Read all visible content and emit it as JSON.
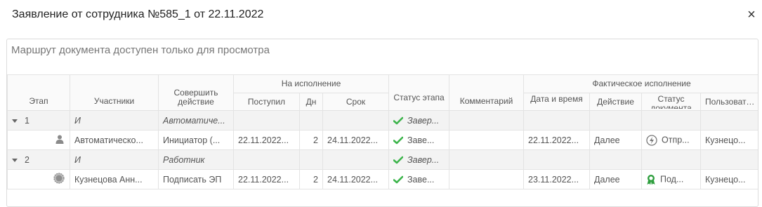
{
  "dialog": {
    "title": "Заявление от сотрудника №585_1 от 22.11.2022",
    "close_label": "×",
    "notice": "Маршрут документа доступен только для просмотра"
  },
  "columns": {
    "stage": "Этап",
    "participants": "Участники",
    "action": "Совершить действие",
    "on_execution": "На исполнение",
    "received": "Поступил",
    "days": "Дн",
    "deadline": "Срок",
    "stage_status": "Статус этапа",
    "comment": "Комментарий",
    "actual_execution": "Фактическое исполнение",
    "datetime": "Дата и время",
    "action_done": "Действие",
    "doc_status": "Статус документа",
    "user": "Пользовате..."
  },
  "rows": [
    {
      "type": "group",
      "stage": "1",
      "participants": "И",
      "action": "Автоматиче...",
      "received": "",
      "days": "",
      "deadline": "",
      "stage_status": "Завер...",
      "comment": "",
      "datetime": "",
      "action_done": "",
      "doc_status": "",
      "user": ""
    },
    {
      "type": "item",
      "icon": "person-icon",
      "participants": "Автоматическо...",
      "action": "Инициатор (...",
      "received": "22.11.2022...",
      "days": "2",
      "deadline": "24.11.2022...",
      "stage_status": "Заве...",
      "comment": "",
      "datetime": "22.11.2022...",
      "action_done": "Далее",
      "doc_status": "Отпр...",
      "doc_status_icon": "lightning-circle-icon",
      "user": "Кузнецо..."
    },
    {
      "type": "group",
      "stage": "2",
      "participants": "И",
      "action": "Работник",
      "received": "",
      "days": "",
      "deadline": "",
      "stage_status": "Завер...",
      "comment": "",
      "datetime": "",
      "action_done": "",
      "doc_status": "",
      "user": ""
    },
    {
      "type": "item",
      "icon": "user-avatar-icon",
      "participants": "Кузнецова Анн...",
      "action": "Подписать ЭП",
      "received": "22.11.2022...",
      "days": "2",
      "deadline": "24.11.2022...",
      "stage_status": "Заве...",
      "comment": "",
      "datetime": "23.11.2022...",
      "action_done": "Далее",
      "doc_status": "Под...",
      "doc_status_icon": "award-badge-icon",
      "user": "Кузнецо..."
    }
  ],
  "colors": {
    "check": "#3cb44b",
    "award": "#2e9e3e"
  }
}
